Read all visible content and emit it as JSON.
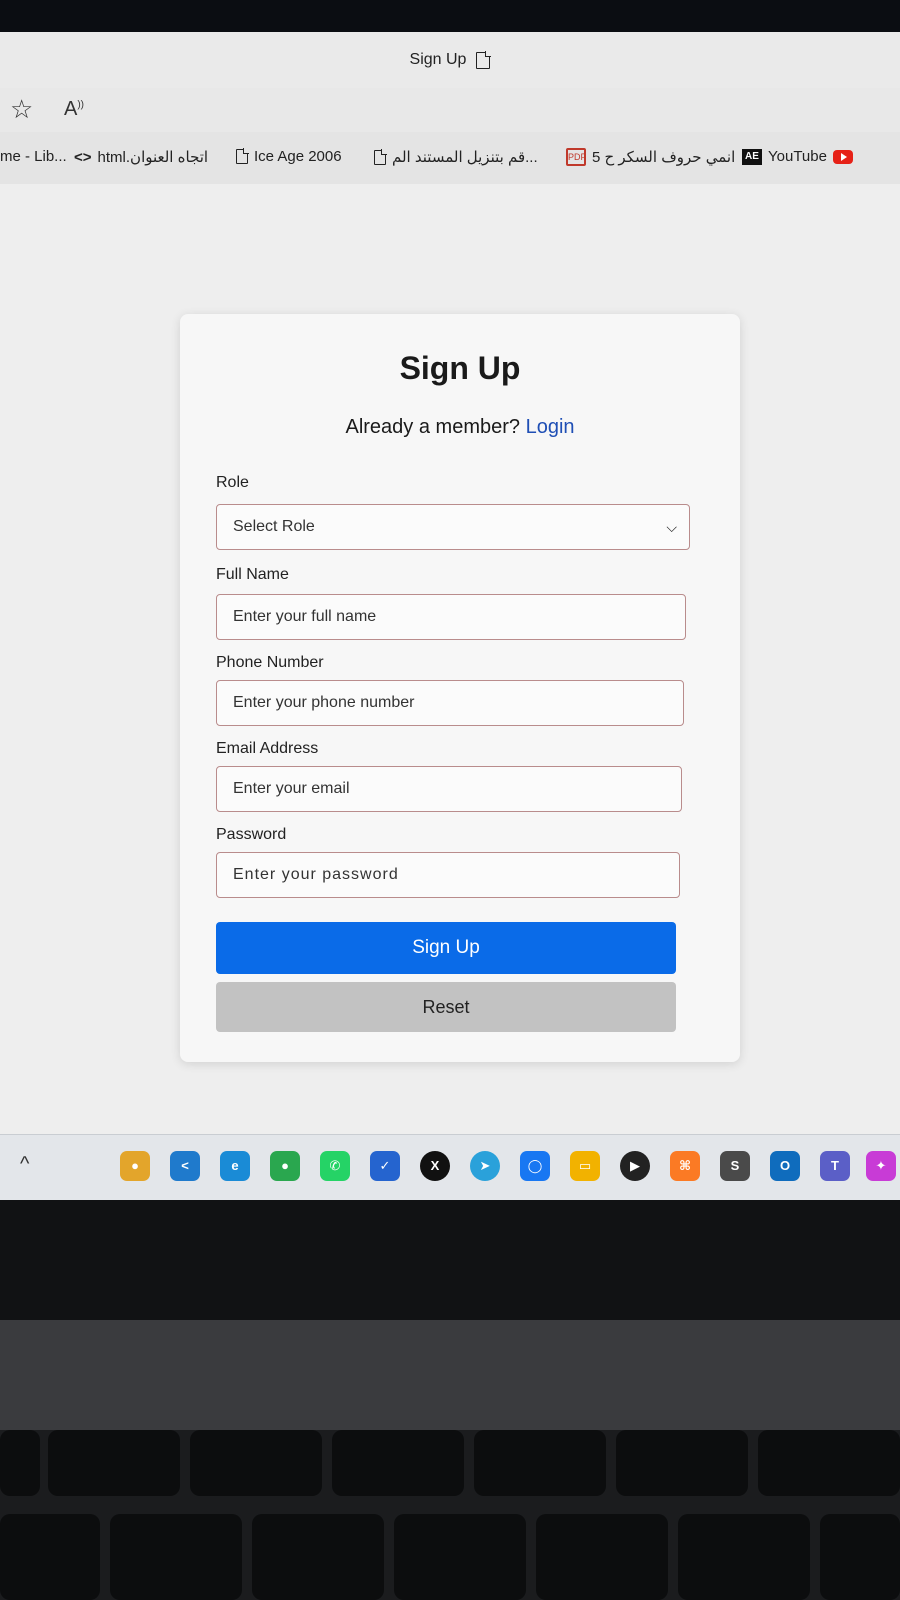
{
  "browser": {
    "tab_title": "Sign Up",
    "bookmarks": [
      {
        "label": "me - Lib..."
      },
      {
        "label": "html.اتجاه العنوان"
      },
      {
        "label": "Ice Age 2006"
      },
      {
        "label": "قم بتنزيل المستند الم..."
      },
      {
        "label": "انمي حروف السكر ح 5"
      },
      {
        "label": "YouTube"
      }
    ]
  },
  "form": {
    "title": "Sign Up",
    "member_prompt": "Already a member?",
    "login_link": "Login",
    "role_label": "Role",
    "role_value": "Select Role",
    "fullname_label": "Full Name",
    "fullname_placeholder": "Enter your full name",
    "phone_label": "Phone Number",
    "phone_placeholder": "Enter your phone number",
    "email_label": "Email Address",
    "email_placeholder": "Enter your email",
    "password_label": "Password",
    "password_placeholder": "Enter your password",
    "signup_button": "Sign Up",
    "reset_button": "Reset"
  },
  "colors": {
    "primary": "#0a6be8",
    "secondary": "#c2c2c2",
    "link": "#1f4fb5"
  },
  "taskbar_icons": [
    "chrome-canary-icon",
    "vscode-icon",
    "edge-icon",
    "chrome-icon",
    "whatsapp-icon",
    "todo-icon",
    "x-icon",
    "telegram-icon",
    "messenger-icon",
    "file-explorer-icon",
    "media-player-icon",
    "xampp-icon",
    "sublime-icon",
    "outlook-icon",
    "teams-icon",
    "copilot-icon"
  ]
}
